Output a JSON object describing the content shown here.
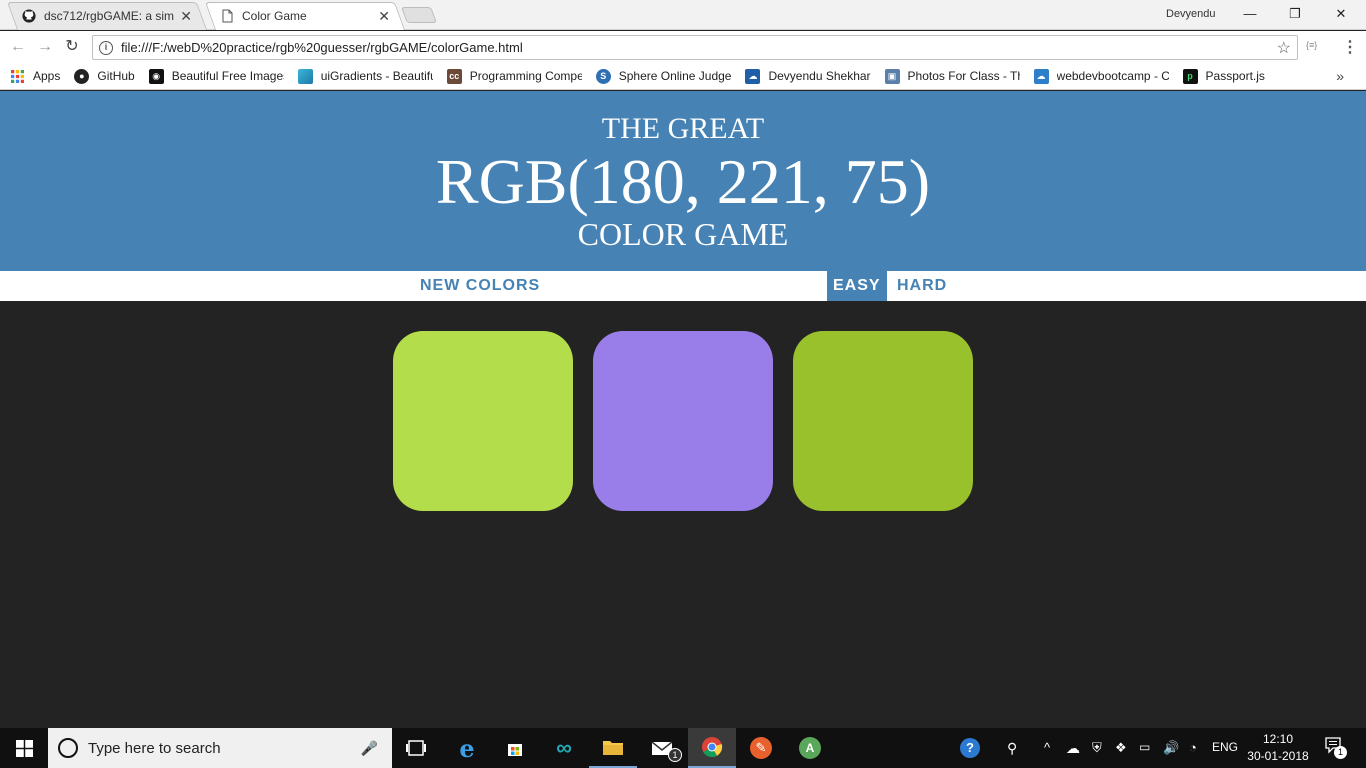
{
  "browser": {
    "tabs": [
      {
        "title": "dsc712/rgbGAME: a simp",
        "icon": "github-icon"
      },
      {
        "title": "Color Game",
        "icon": "document-icon"
      }
    ],
    "user_name": "Devyendu",
    "url": "file:///F:/webD%20practice/rgb%20guesser/rgbGAME/colorGame.html",
    "ext_label": "{≡}",
    "bookmarks": [
      {
        "label": "Apps",
        "icon": "apps-grid-icon"
      },
      {
        "label": "GitHub",
        "icon": "github-icon"
      },
      {
        "label": "Beautiful Free Images",
        "icon": "camera-icon"
      },
      {
        "label": "uiGradients - Beautifu",
        "icon": "gradient-icon"
      },
      {
        "label": "Programming Compe",
        "icon": "cc-icon"
      },
      {
        "label": "Sphere Online Judge",
        "icon": "spoj-icon"
      },
      {
        "label": "Devyendu Shekhar",
        "icon": "cloud-icon"
      },
      {
        "label": "Photos For Class - Th",
        "icon": "photos-icon"
      },
      {
        "label": "webdevbootcamp - C",
        "icon": "cloud9-icon"
      },
      {
        "label": "Passport.js",
        "icon": "passport-icon"
      }
    ]
  },
  "game": {
    "title_top": "THE GREAT",
    "rgb_display": "RGB(180, 221, 75)",
    "title_bottom": "COLOR GAME",
    "new_colors_label": "NEW COLORS",
    "easy_label": "EASY",
    "hard_label": "HARD",
    "header_color": "#4682b4",
    "square_colors": [
      "#b4dd4b",
      "#997eea",
      "#99c12c"
    ]
  },
  "taskbar": {
    "search_placeholder": "Type here to search",
    "language": "ENG",
    "time": "12:10",
    "date": "30-01-2018",
    "notification_count": "1",
    "mail_count": "1"
  }
}
